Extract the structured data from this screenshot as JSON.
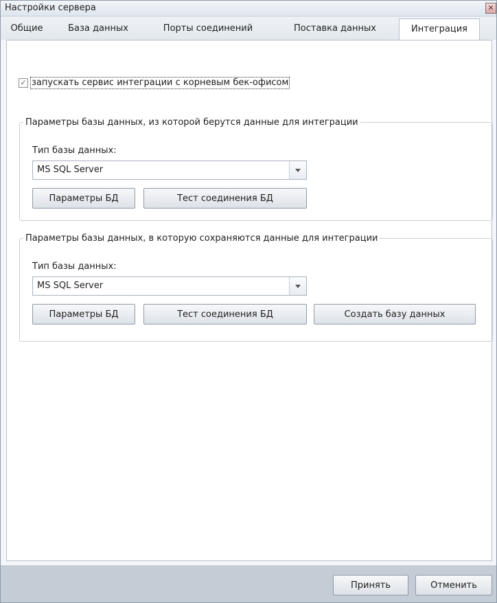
{
  "window": {
    "title": "Настройки сервера"
  },
  "tabs": [
    {
      "label": "Общие"
    },
    {
      "label": "База данных"
    },
    {
      "label": "Порты соединений"
    },
    {
      "label": "Поставка данных"
    },
    {
      "label": "Интеграция",
      "active": true
    }
  ],
  "integration": {
    "enable_checkbox": {
      "label": "запускать сервис интеграции с корневым бек-офисом",
      "checked": true
    }
  },
  "source_group": {
    "legend": "Параметры базы данных, из которой берутся данные для интеграции",
    "db_type_label": "Тип базы данных:",
    "db_type_value": "MS SQL Server",
    "params_button": "Параметры БД",
    "test_button": "Тест соединения БД"
  },
  "target_group": {
    "legend": "Параметры базы данных, в которую сохраняются данные для интеграции",
    "db_type_label": "Тип базы данных:",
    "db_type_value": "MS SQL Server",
    "params_button": "Параметры БД",
    "test_button": "Тест соединения БД",
    "create_button": "Создать базу данных"
  },
  "footer": {
    "accept_button": "Принять",
    "cancel_button": "Отменить"
  }
}
